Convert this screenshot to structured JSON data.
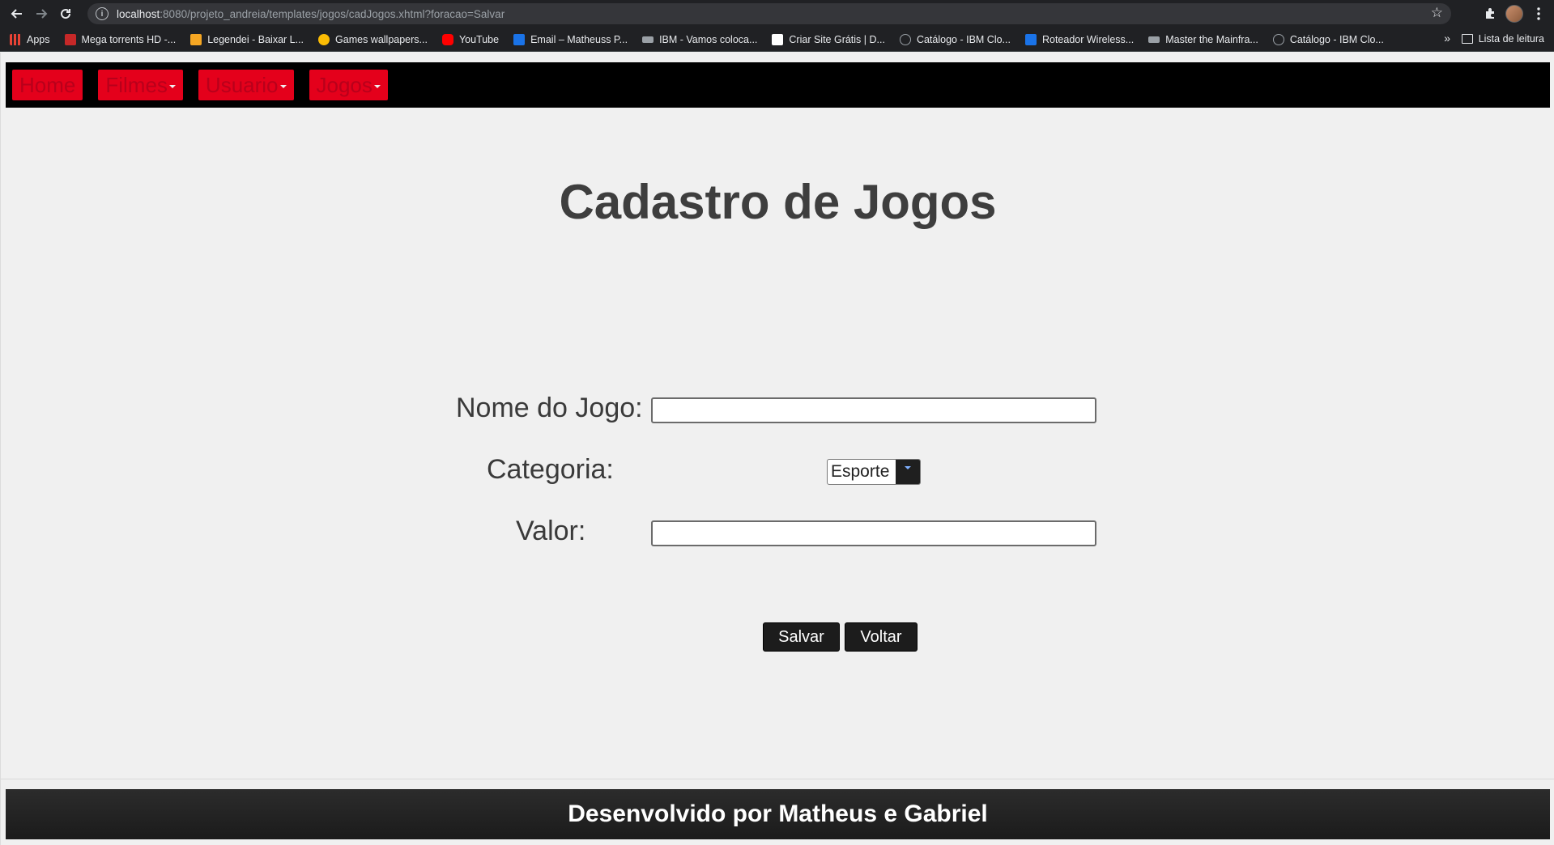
{
  "browser": {
    "url_host": "localhost",
    "url_rest": ":8080/projeto_andreia/templates/jogos/cadJogos.xhtml?foracao=Salvar",
    "bookmarks": [
      {
        "label": "Apps",
        "color": "#ea4335"
      },
      {
        "label": "Mega torrents HD -...",
        "color": "#c62828"
      },
      {
        "label": "Legendei - Baixar L...",
        "color": "#f5a623"
      },
      {
        "label": "Games wallpapers...",
        "color": "#fbbc04"
      },
      {
        "label": "YouTube",
        "color": "#ff0000"
      },
      {
        "label": "Email – Matheuss P...",
        "color": "#1a73e8"
      },
      {
        "label": "IBM - Vamos coloca...",
        "color": "#9aa0a6"
      },
      {
        "label": "Criar Site Grátis | D...",
        "color": "#ffffff"
      },
      {
        "label": "Catálogo - IBM Clo...",
        "color": "#5f6368"
      },
      {
        "label": "Roteador Wireless...",
        "color": "#1a73e8"
      },
      {
        "label": "Master the Mainfra...",
        "color": "#9aa0a6"
      },
      {
        "label": "Catálogo - IBM Clo...",
        "color": "#5f6368"
      }
    ],
    "reading_list": "Lista de leitura"
  },
  "nav": {
    "items": [
      {
        "label": "Home",
        "has_dropdown": false
      },
      {
        "label": "Filmes",
        "has_dropdown": true
      },
      {
        "label": "Usuario",
        "has_dropdown": true
      },
      {
        "label": "Jogos",
        "has_dropdown": true
      }
    ]
  },
  "page": {
    "title": "Cadastro de Jogos"
  },
  "form": {
    "nome_label": "Nome do Jogo:",
    "nome_value": "",
    "categoria_label": "Categoria:",
    "categoria_value": "Esporte",
    "valor_label": "Valor:",
    "valor_value": "",
    "save_label": "Salvar",
    "back_label": "Voltar"
  },
  "footer": {
    "text": "Desenvolvido por Matheus e Gabriel"
  },
  "colors": {
    "nav_bg": "#000000",
    "menu_red": "#e4001b",
    "title_text": "#3e3e3e",
    "button_bg": "#1c1c1c"
  }
}
